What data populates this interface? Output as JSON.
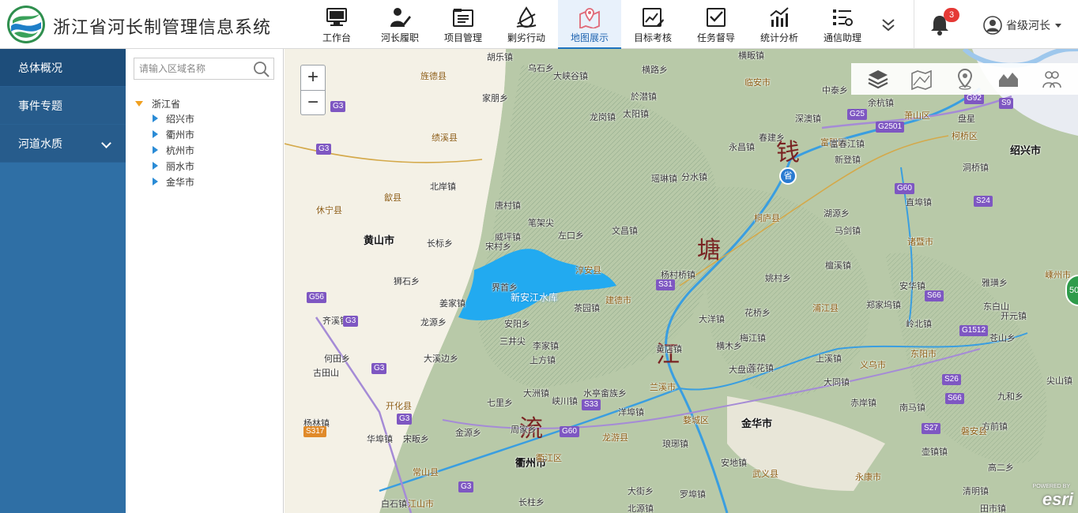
{
  "app": {
    "title": "浙江省河长制管理信息系统"
  },
  "nav": {
    "items": [
      {
        "label": "工作台",
        "icon": "monitor-icon"
      },
      {
        "label": "河长履职",
        "icon": "person-writing-icon"
      },
      {
        "label": "项目管理",
        "icon": "folder-list-icon"
      },
      {
        "label": "剿劣行动",
        "icon": "water-drop-icon"
      },
      {
        "label": "地图展示",
        "icon": "map-pin-icon",
        "active": true
      },
      {
        "label": "目标考核",
        "icon": "chart-edit-icon"
      },
      {
        "label": "任务督导",
        "icon": "task-check-icon"
      },
      {
        "label": "统计分析",
        "icon": "bar-chart-icon"
      },
      {
        "label": "通信助理",
        "icon": "list-settings-icon"
      }
    ],
    "more_icon": "double-chevron-down-icon"
  },
  "notifications": {
    "count": "3"
  },
  "user": {
    "label": "省级河长"
  },
  "sidebar": {
    "items": [
      {
        "label": "总体概况",
        "active": true
      },
      {
        "label": "事件专题"
      },
      {
        "label": "河道水质",
        "expandable": true
      }
    ]
  },
  "tree": {
    "search_placeholder": "请输入区域名称",
    "root": "浙江省",
    "children": [
      "绍兴市",
      "衢州市",
      "杭州市",
      "丽水市",
      "金华市"
    ]
  },
  "map": {
    "zoom_in": "+",
    "zoom_out": "−",
    "tools": [
      "layers-icon",
      "map-icon",
      "location-pin-icon",
      "terrain-icon",
      "people-icon"
    ],
    "pin_label": "省",
    "green_badge": "50",
    "powered_by": "POWERED BY",
    "attribution": "esri",
    "river_chars": [
      "钱",
      "塘",
      "江",
      "流"
    ],
    "cities": [
      "黄山市",
      "衢州市",
      "金华市",
      "绍兴市",
      "建德市",
      "兰溪市",
      "常山县",
      "开化县",
      "龙游县",
      "义乌市",
      "永康市",
      "磐安县",
      "嵊州市",
      "诸暨市",
      "浦江县",
      "桐庐县",
      "富阳区",
      "萧山区",
      "临安市",
      "淳安县",
      "休宁县",
      "歙县",
      "绩溪县",
      "旌德县",
      "婺城区",
      "东阳市",
      "武义县",
      "柯桥区",
      "衢江区",
      "江山市"
    ],
    "towns": [
      "胡乐镇",
      "乌石乡",
      "大峡谷镇",
      "横畈镇",
      "横路乡",
      "家朋乡",
      "於潜镇",
      "太阳镇",
      "龙岗镇",
      "永昌镇",
      "春建乡",
      "新登镇",
      "分水镇",
      "瑶琳镇",
      "富春江镇",
      "深澳镇",
      "唐村镇",
      "左口乡",
      "文昌镇",
      "威坪镇",
      "宋村乡",
      "界首乡",
      "姜家镇",
      "龙源乡",
      "安阳乡",
      "三井尖",
      "李家镇",
      "上方镇",
      "大溪边乡",
      "何田乡",
      "古田山",
      "杨林镇",
      "华埠镇",
      "宋畈乡",
      "金源乡",
      "周家乡",
      "大洲镇",
      "七里乡",
      "峡川镇",
      "水亭畲族乡",
      "洋埠镇",
      "杨村桥镇",
      "大洋镇",
      "横木乡",
      "梅江镇",
      "黄店镇",
      "大盘山",
      "上溪镇",
      "赤岸镇",
      "南马镇",
      "方前镇",
      "直埠镇",
      "湖源乡",
      "马剑镇",
      "檀溪镇",
      "姚村乡",
      "花桥乡",
      "郑家坞镇",
      "安华镇",
      "岭北镇",
      "雅璜乡",
      "东白山",
      "开元镇",
      "九和乡",
      "尖山镇",
      "高二乡",
      "清明镇",
      "田市镇",
      "壶镇镇",
      "安地镇",
      "琅琊镇",
      "罗埠镇",
      "大街乡",
      "北源镇",
      "长柱乡",
      "白石镇",
      "狮石乡",
      "齐溪镇",
      "北岸镇",
      "长标乡",
      "中泰乡",
      "余杭镇",
      "盘星",
      "洞桥镇",
      "茶园镇",
      "大同镇",
      "苍山乡",
      "莲花镇",
      "笔架尖"
    ],
    "shields": [
      "G3",
      "G56",
      "G60",
      "S31",
      "S33",
      "S26",
      "S27",
      "S66",
      "G1512",
      "G2501",
      "G92",
      "S9",
      "S24",
      "G25",
      "S317"
    ]
  }
}
